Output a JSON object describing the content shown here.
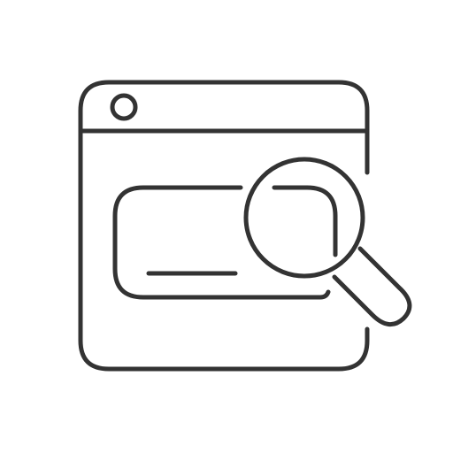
{
  "icon": {
    "name": "browser-search-icon",
    "stroke_color": "#333333",
    "background_color": "#ffffff",
    "parts": {
      "window": "browser-window-icon",
      "search_bar": "search-bar-icon",
      "magnifier": "magnifying-glass-icon"
    }
  }
}
